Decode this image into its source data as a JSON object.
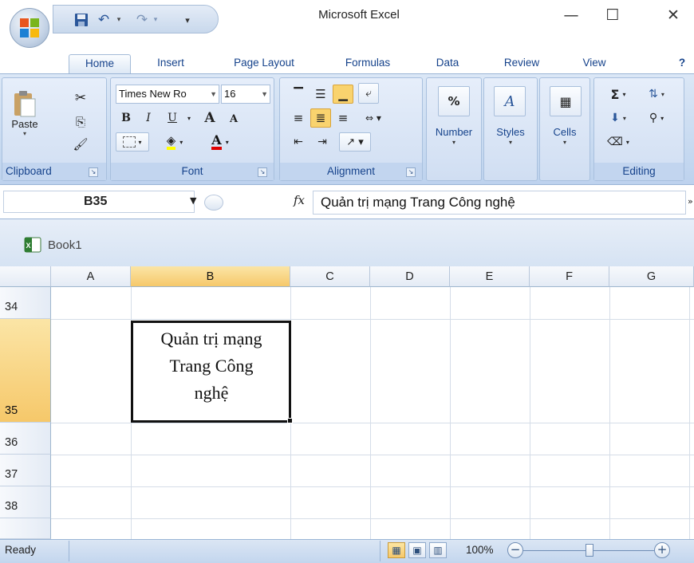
{
  "app": {
    "title": "Microsoft Excel",
    "minimize_icon": "—",
    "maximize_icon": "☐",
    "close_icon": "✕"
  },
  "quick_access": {
    "save_icon": "save-icon",
    "undo_icon": "undo-icon",
    "redo_icon": "redo-icon"
  },
  "tabs": [
    "Home",
    "Insert",
    "Page Layout",
    "Formulas",
    "Data",
    "Review",
    "View"
  ],
  "ribbon": {
    "clipboard": {
      "label": "Clipboard",
      "paste_label": "Paste"
    },
    "font": {
      "label": "Font",
      "font_name": "Times New Ro",
      "font_size": "16",
      "bold": "B",
      "italic": "I",
      "underline": "U",
      "grow": "A",
      "shrink": "A"
    },
    "alignment": {
      "label": "Alignment"
    },
    "number": {
      "label": "Number",
      "percent": "%"
    },
    "styles": {
      "label": "Styles"
    },
    "cells": {
      "label": "Cells"
    },
    "editing": {
      "label": "Editing",
      "sum": "Σ"
    }
  },
  "formula_bar": {
    "name_box": "B35",
    "fx": "fx",
    "formula": "Quản trị mạng Trang Công nghệ"
  },
  "workbook": {
    "title": "Book1"
  },
  "sheet": {
    "columns": [
      "A",
      "B",
      "C",
      "D",
      "E",
      "F",
      "G"
    ],
    "rows": [
      "34",
      "35",
      "36",
      "37",
      "38"
    ],
    "active_cell": "B35",
    "active_cell_lines": [
      "Quản trị mạng",
      "Trang Công",
      "nghệ"
    ]
  },
  "status": {
    "ready": "Ready",
    "zoom": "100%"
  },
  "colors": {
    "ribbon_bg": "#c6d9f0",
    "tab_text": "#15428b",
    "selected_header": "#f6c86a"
  }
}
